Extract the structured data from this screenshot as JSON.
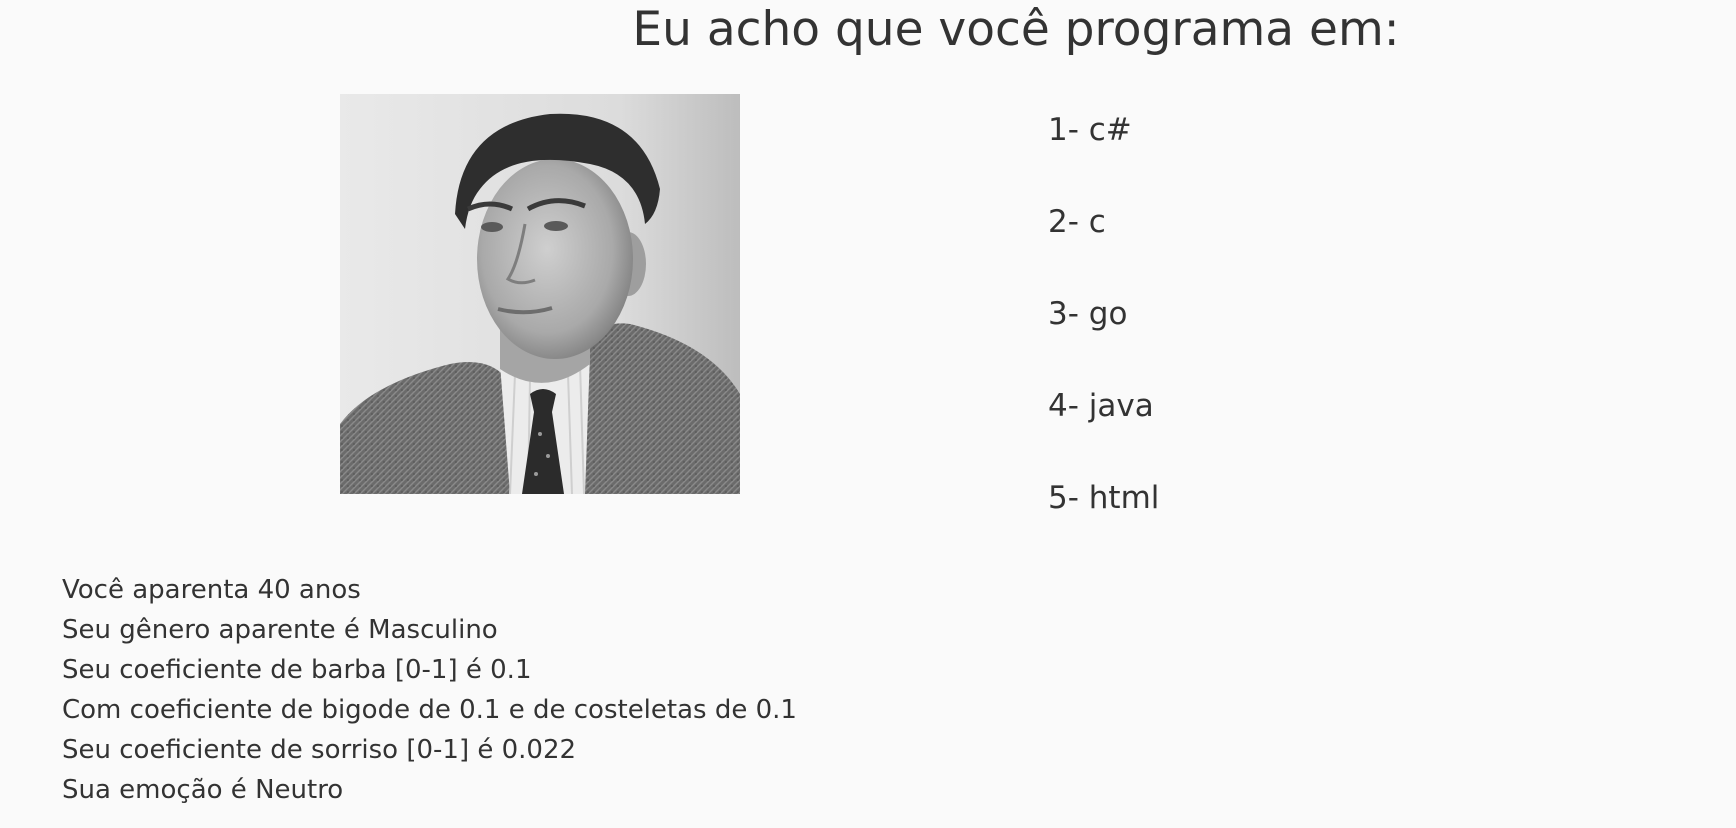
{
  "header": {
    "title": "Eu acho que você programa em:"
  },
  "photo": {
    "icon": "portrait-photo"
  },
  "languages": [
    {
      "label": "1- c#"
    },
    {
      "label": "2- c"
    },
    {
      "label": "3- go"
    },
    {
      "label": "4- java"
    },
    {
      "label": "5- html"
    }
  ],
  "analysis": [
    {
      "text": "Você aparenta 40 anos"
    },
    {
      "text": "Seu gênero aparente é Masculino"
    },
    {
      "text": "Seu coeficiente de barba [0-1] é 0.1"
    },
    {
      "text": "Com coeficiente de bigode de 0.1 e de costeletas de 0.1"
    },
    {
      "text": "Seu coeficiente de sorriso [0-1] é 0.022"
    },
    {
      "text": "Sua emoção é Neutro"
    }
  ],
  "colors": {
    "background": "#fafafa",
    "text": "#333333"
  }
}
